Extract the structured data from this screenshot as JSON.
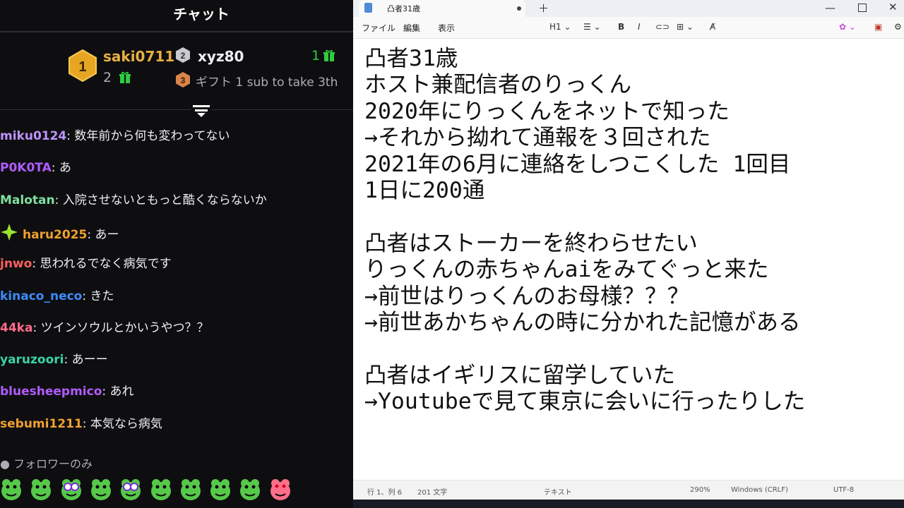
{
  "chat": {
    "title": "チャット",
    "leaderboard": {
      "first": {
        "rank": "1",
        "name": "saki0711",
        "count": "2"
      },
      "second": {
        "rank": "2",
        "name": "xyz80",
        "count": "1"
      },
      "third": {
        "rank": "3",
        "cta": "ギフト 1 sub to take 3th"
      }
    },
    "messages": [
      {
        "user": "miku0124",
        "color": "#bf94ff",
        "text": "数年前から何も変わってない"
      },
      {
        "user": "P0K0TA",
        "color": "#b05cff",
        "text": "あ"
      },
      {
        "user": "Malotan",
        "color": "#7fe1a0",
        "text": "入院させないともっと酷くならないか"
      },
      {
        "user": "haru2025",
        "color": "#f0a030",
        "text": "あー",
        "icon": "sparkle-icon"
      },
      {
        "user": "jnwo",
        "color": "#ff5f5f",
        "text": "思われるでなく病気です"
      },
      {
        "user": "kinaco_neco",
        "color": "#3d8bff",
        "text": "きた"
      },
      {
        "user": "44ka",
        "color": "#ff6b8a",
        "text": "ツインソウルとかいうやつ？？"
      },
      {
        "user": "yaruzoori",
        "color": "#39d3a5",
        "text": "あーー"
      },
      {
        "user": "bluesheepmico",
        "color": "#b05cff",
        "text": "あれ"
      },
      {
        "user": "sebumi1211",
        "color": "#f0a030",
        "text": "本気なら病気"
      }
    ],
    "mode_label": "フォロワーのみ",
    "emotes": [
      "frog-emote",
      "angry-frog-emote",
      "dizzy-frog-emote",
      "laughing-frog-emote",
      "crying-frog-emote",
      "smiling-frog-emote",
      "grinning-frog-emote",
      "shy-frog-emote",
      "smug-frog-emote",
      "heart-eyes-frog-emote"
    ]
  },
  "notepad": {
    "tab_title": "凸者31歳",
    "menu": {
      "file": "ファイル",
      "edit": "編集",
      "view": "表示"
    },
    "toolbar": {
      "heading": "H1"
    },
    "lines": [
      "凸者31歳",
      "ホスト兼配信者のりっくん",
      "2020年にりっくんをネットで知った",
      "→それから拗れて通報を３回された",
      "2021年の6月に連絡をしつこくした 1回目",
      "1日に200通",
      "",
      "凸者はストーカーを終わらせたい",
      "りっくんの赤ちゃんaiをみてぐっと来た",
      "→前世はりっくんのお母様？？？",
      "→前世あかちゃんの時に分かれた記憶がある",
      "",
      "凸者はイギリスに留学していた",
      "→Youtubeで見て東京に会いに行ったりした"
    ],
    "status": {
      "position": "行 1、列 6",
      "chars": "201 文字",
      "format": "テキスト",
      "zoom": "290%",
      "line_ending": "Windows (CRLF)",
      "encoding": "UTF-8"
    }
  }
}
